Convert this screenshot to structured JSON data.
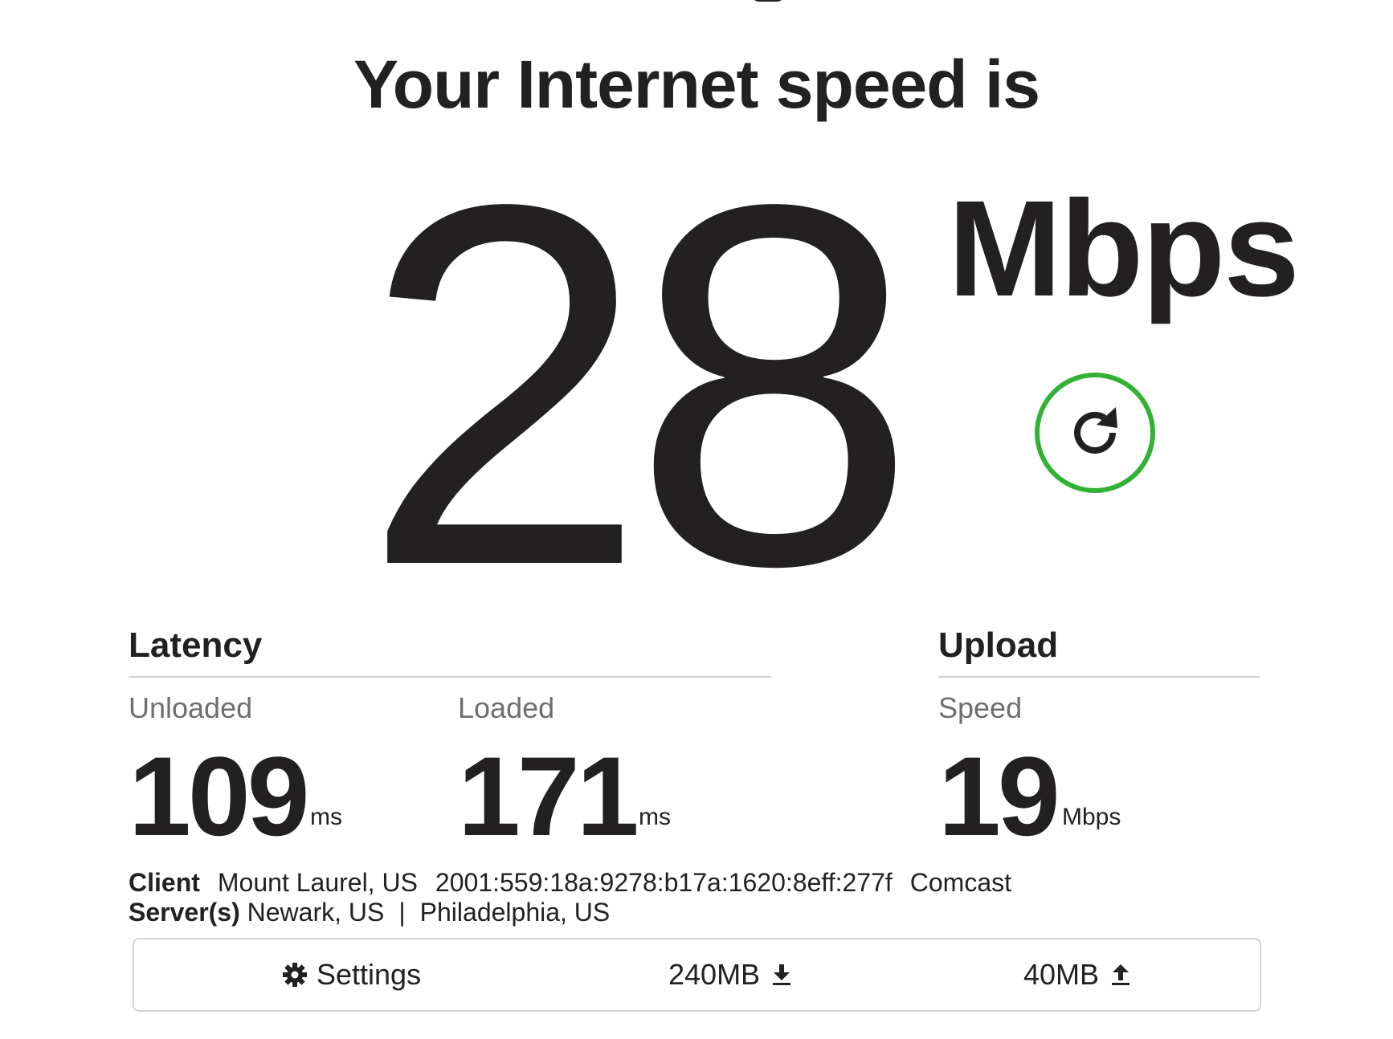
{
  "header": {
    "title": "Your Internet speed is"
  },
  "download": {
    "value": "28",
    "unit": "Mbps"
  },
  "retest": {
    "icon": "refresh-icon",
    "accent_color": "#32b235"
  },
  "latency": {
    "title": "Latency",
    "unloaded": {
      "label": "Unloaded",
      "value": "109",
      "unit": "ms"
    },
    "loaded": {
      "label": "Loaded",
      "value": "171",
      "unit": "ms"
    }
  },
  "upload": {
    "title": "Upload",
    "speed": {
      "label": "Speed",
      "value": "19",
      "unit": "Mbps"
    }
  },
  "client": {
    "label": "Client",
    "location": "Mount Laurel, US",
    "ip": "2001:559:18a:9278:b17a:1620:8eff:277f",
    "isp": "Comcast"
  },
  "servers": {
    "label": "Server(s)",
    "primary": "Newark, US",
    "separator": "|",
    "secondary": "Philadelphia, US"
  },
  "footer": {
    "settings_label": "Settings",
    "settings_icon": "gear-icon",
    "download_size": "240MB",
    "download_icon": "download-icon",
    "upload_size": "40MB",
    "upload_icon": "upload-icon"
  }
}
